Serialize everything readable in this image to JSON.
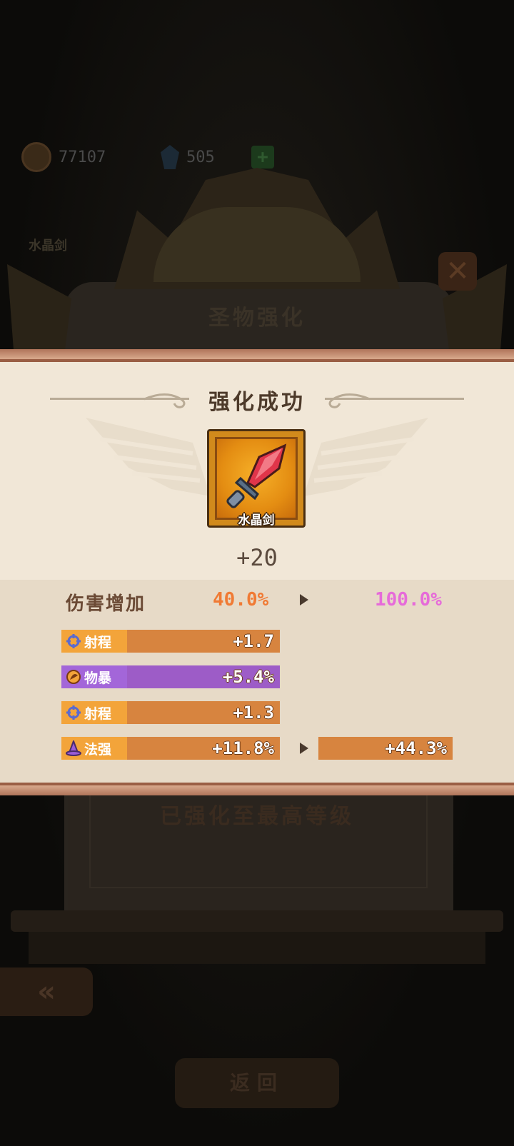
{
  "resources": {
    "coins": "77107",
    "gems": "505"
  },
  "background": {
    "item_name": "水晶剑",
    "panel_title": "圣物强化",
    "max_level_text": "已强化至最高等级",
    "bottom_button": "返回"
  },
  "result": {
    "title": "强化成功",
    "item_name": "水晶剑",
    "level": "+20",
    "damage": {
      "label": "伤害增加",
      "old": "40.0%",
      "new": "100.0%"
    },
    "stats": [
      {
        "icon": "crosshair-icon",
        "label": "射程",
        "value": "+1.7",
        "color": "orange"
      },
      {
        "icon": "crit-icon",
        "label": "物暴",
        "value": "+5.4%",
        "color": "purple"
      },
      {
        "icon": "crosshair-icon",
        "label": "射程",
        "value": "+1.3",
        "color": "orange"
      },
      {
        "icon": "wizard-hat-icon",
        "label": "法强",
        "value": "+11.8%",
        "color": "orange",
        "new_value": "+44.3%"
      }
    ]
  },
  "colors": {
    "accent_orange": "#f07a34",
    "accent_pink": "#e66bd9",
    "bar_orange": "#d7843f",
    "bar_purple": "#9d5cc7"
  }
}
